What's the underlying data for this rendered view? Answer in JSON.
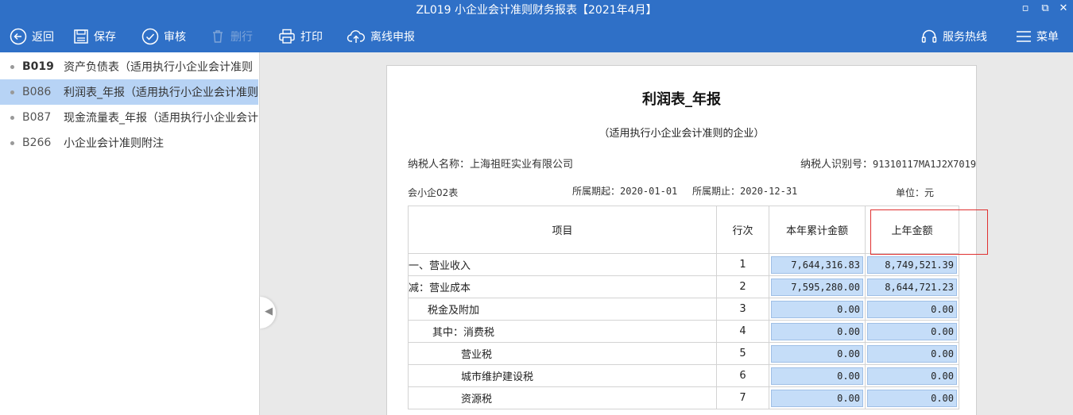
{
  "window": {
    "title": "ZL019 小企业会计准则财务报表【2021年4月】",
    "controls": {
      "minimize": "▫",
      "restore": "⧉",
      "close": "✕"
    }
  },
  "toolbar": {
    "back": "返回",
    "save": "保存",
    "review": "审核",
    "delete": "删行",
    "print": "打印",
    "offline": "离线申报",
    "hotline": "服务热线",
    "menu": "菜单"
  },
  "sidebar": {
    "items": [
      {
        "code": "B019",
        "name": "资产负债表（适用执行小企业会计准则",
        "active": false,
        "bold": true
      },
      {
        "code": "B086",
        "name": "利润表_年报（适用执行小企业会计准则",
        "active": true,
        "bold": false
      },
      {
        "code": "B087",
        "name": "现金流量表_年报（适用执行小企业会计",
        "active": false,
        "bold": false
      },
      {
        "code": "B266",
        "name": "小企业会计准则附注",
        "active": false,
        "bold": false
      }
    ]
  },
  "report": {
    "title": "利润表_年报",
    "subtitle": "（适用执行小企业会计准则的企业）",
    "taxpayer_name_label": "纳税人名称：",
    "taxpayer_name": "上海祖旺实业有限公司",
    "taxpayer_id_label": "纳税人识别号：",
    "taxpayer_id": "91310117MA1J2X7019",
    "form_code": "会小企02表",
    "period_start_label": "所属期起：",
    "period_start": "2020-01-01",
    "period_end_label": "所属期止：",
    "period_end": "2020-12-31",
    "unit_label": "单位：",
    "unit": "元",
    "columns": {
      "item": "项目",
      "line": "行次",
      "current": "本年累计金额",
      "previous": "上年金额"
    },
    "rows": [
      {
        "item": "一、营业收入",
        "line": "1",
        "current": "7,644,316.83",
        "previous": "8,749,521.39"
      },
      {
        "item": "减：营业成本",
        "line": "2",
        "current": "7,595,280.00",
        "previous": "8,644,721.23"
      },
      {
        "item": "税金及附加",
        "line": "3",
        "current": "0.00",
        "previous": "0.00"
      },
      {
        "item": "其中：消费税",
        "line": "4",
        "current": "0.00",
        "previous": "0.00"
      },
      {
        "item": "营业税",
        "line": "5",
        "current": "0.00",
        "previous": "0.00"
      },
      {
        "item": "城市维护建设税",
        "line": "6",
        "current": "0.00",
        "previous": "0.00"
      },
      {
        "item": "资源税",
        "line": "7",
        "current": "0.00",
        "previous": "0.00"
      }
    ]
  },
  "colors": {
    "accent": "#2f70c7",
    "active_row": "#b7d3f5",
    "input_fill": "#c5ddf8",
    "highlight": "#e03030"
  }
}
